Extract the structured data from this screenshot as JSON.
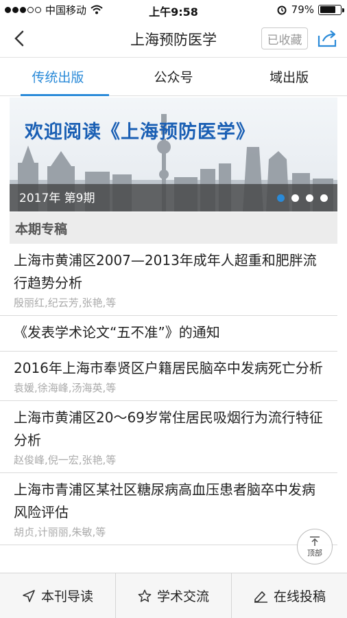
{
  "status_bar": {
    "carrier": "中国移动",
    "time": "上午9:58",
    "battery": "79%",
    "battery_level": 0.79
  },
  "navbar": {
    "title": "上海预防医学",
    "favorite_label": "已收藏",
    "back_icon": "chevron-left-icon",
    "share_icon": "share-icon"
  },
  "tabs": [
    {
      "label": "传统出版",
      "active": true
    },
    {
      "label": "公众号",
      "active": false
    },
    {
      "label": "域出版",
      "active": false
    }
  ],
  "banner": {
    "title": "欢迎阅读《上海预防医学》",
    "issue": "2017年 第9期",
    "pages": 4,
    "current_page": 1
  },
  "section_title": "本期专稿",
  "articles": [
    {
      "title": "上海市黄浦区2007—2013年成年人超重和肥胖流行趋势分析",
      "authors": "殷丽红,纪云芳,张艳,等"
    },
    {
      "title": "《发表学术论文“五不准”》的通知",
      "authors": ""
    },
    {
      "title": "2016年上海市奉贤区户籍居民脑卒中发病死亡分析",
      "authors": "袁媛,徐海峰,汤海英,等"
    },
    {
      "title": "上海市黄浦区20～69岁常住居民吸烟行为流行特征分析",
      "authors": "赵俊峰,倪一宏,张艳,等"
    },
    {
      "title": "上海市青浦区某社区糖尿病高血压患者脑卒中发病风险评估",
      "authors": "胡贞,计丽丽,朱敏,等"
    }
  ],
  "back_to_top": {
    "label": "顶部"
  },
  "bottom_bar": [
    {
      "label": "本刊导读",
      "icon": "navigation-arrow-icon"
    },
    {
      "label": "学术交流",
      "icon": "star-icon"
    },
    {
      "label": "在线投稿",
      "icon": "edit-icon"
    }
  ],
  "colors": {
    "accent": "#2a8ad8",
    "banner_title": "#1a5fb4"
  }
}
